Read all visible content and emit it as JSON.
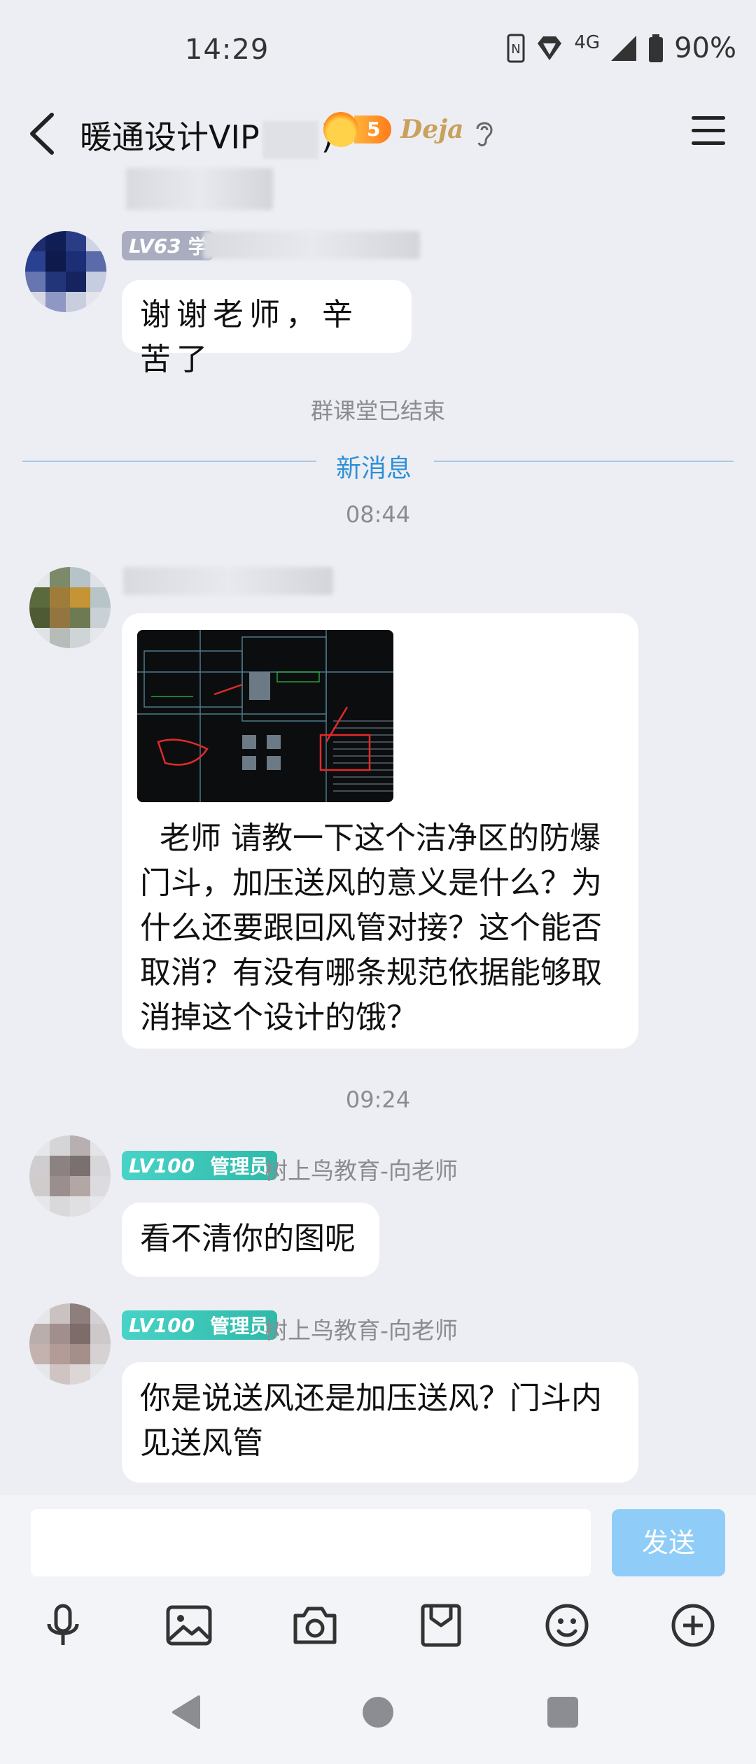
{
  "status_bar": {
    "time": "14:29",
    "network": "4G",
    "battery": "90%"
  },
  "header": {
    "title_start": "暖通设计VIP",
    "title_end": ")",
    "fire_level": "5",
    "deja_label": "Deja"
  },
  "messages": {
    "first": {
      "level": "LV63",
      "name_fragment": "学",
      "text": "谢谢老师，辛苦了"
    },
    "class_ended": "群课堂已结束",
    "new_messages": "新消息",
    "time_1": "08:44",
    "question": {
      "text": "  老师 请教一下这个洁净区的防爆门斗，加压送风的意义是什么？为什么还要跟回风管对接？这个能否取消？有没有哪条规范依据能够取消掉这个设计的饿？"
    },
    "time_2": "09:24",
    "reply_1": {
      "level": "LV100",
      "role": "管理员",
      "sender": "树上鸟教育-向老师",
      "text": "看不清你的图呢"
    },
    "reply_2": {
      "level": "LV100",
      "role": "管理员",
      "sender": "树上鸟教育-向老师",
      "text": "你是说送风还是加压送风？门斗内见送风管"
    }
  },
  "input": {
    "send_label": "发送"
  },
  "toolbar": {
    "icons": [
      "microphone-icon",
      "image-icon",
      "camera-icon",
      "file-icon",
      "emoji-icon",
      "plus-icon"
    ]
  },
  "colors": {
    "new_message_blue": "#2f8fd8",
    "admin_badge": "#3cc9b4",
    "send_button": "#8fcdf8",
    "background": "#eceef3"
  }
}
